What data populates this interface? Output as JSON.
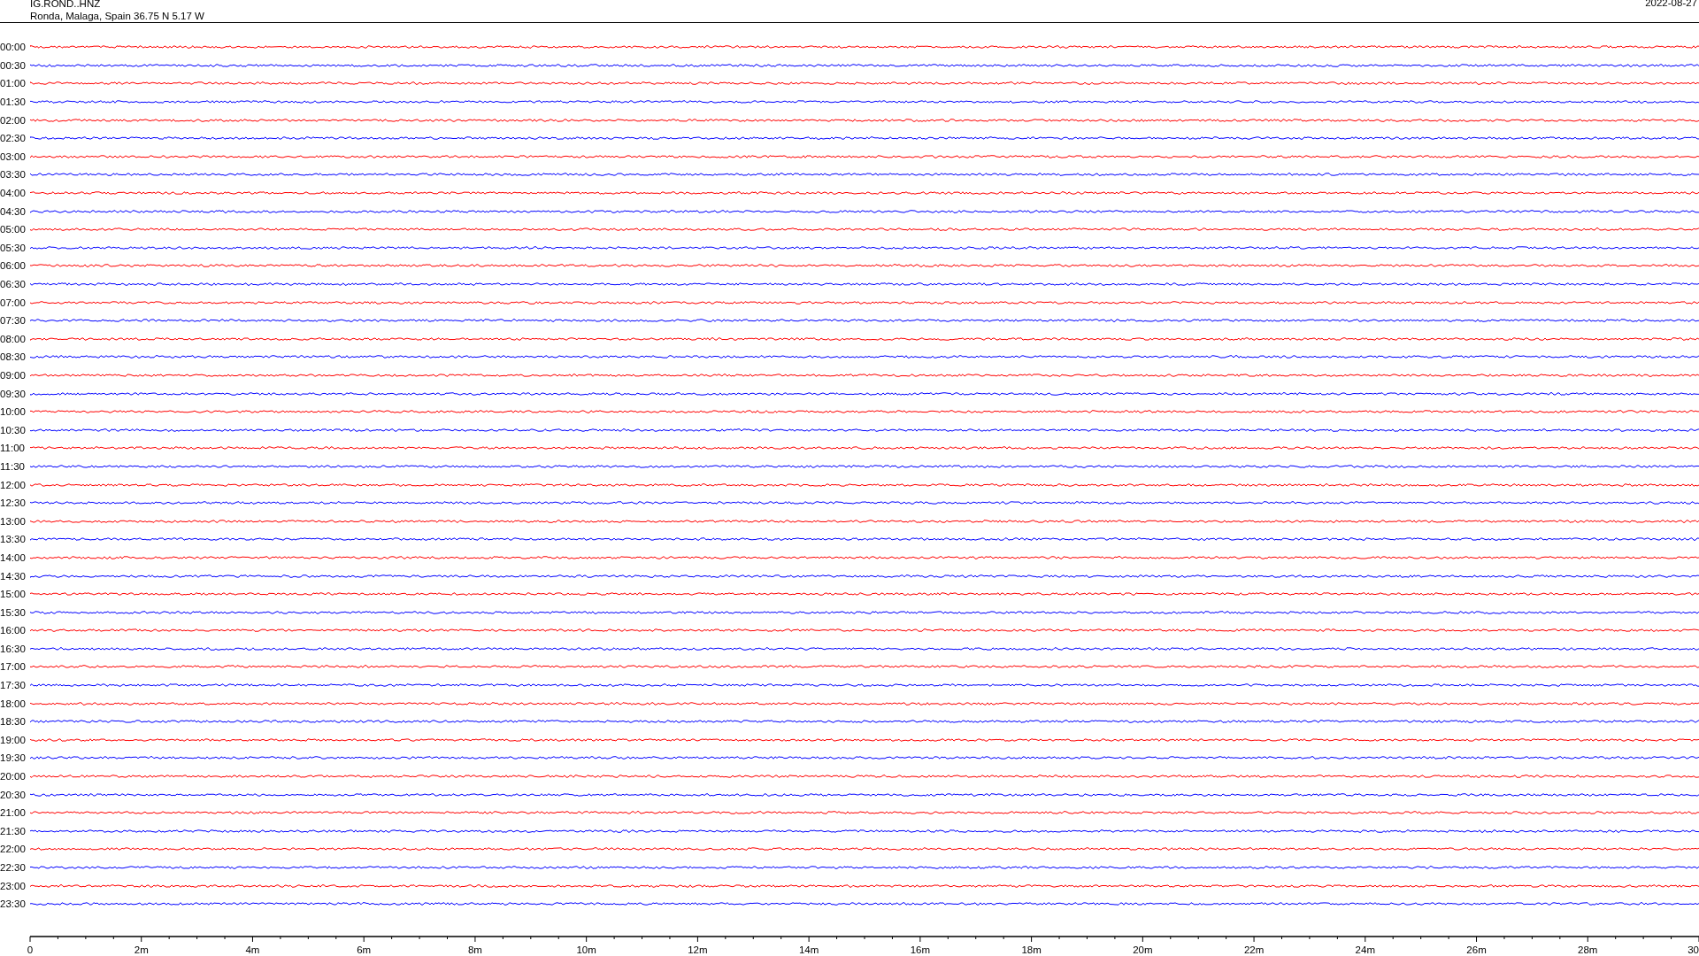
{
  "header": {
    "station": "IG.ROND..HNZ",
    "location": "Ronda, Malaga, Spain  36.75 N 5.17 W",
    "date": "2022-08-27"
  },
  "rows": [
    {
      "time": "00:00",
      "color": "#ff0000"
    },
    {
      "time": "00:30",
      "color": "#0000ff"
    },
    {
      "time": "01:00",
      "color": "#ff0000"
    },
    {
      "time": "01:30",
      "color": "#0000ff"
    },
    {
      "time": "02:00",
      "color": "#ff0000"
    },
    {
      "time": "02:30",
      "color": "#0000ff"
    },
    {
      "time": "03:00",
      "color": "#ff0000"
    },
    {
      "time": "03:30",
      "color": "#0000ff"
    },
    {
      "time": "04:00",
      "color": "#ff0000"
    },
    {
      "time": "04:30",
      "color": "#0000ff"
    },
    {
      "time": "05:00",
      "color": "#ff0000"
    },
    {
      "time": "05:30",
      "color": "#0000ff"
    },
    {
      "time": "06:00",
      "color": "#ff0000"
    },
    {
      "time": "06:30",
      "color": "#0000ff"
    },
    {
      "time": "07:00",
      "color": "#ff0000"
    },
    {
      "time": "07:30",
      "color": "#0000ff"
    },
    {
      "time": "08:00",
      "color": "#ff0000"
    },
    {
      "time": "08:30",
      "color": "#0000ff"
    },
    {
      "time": "09:00",
      "color": "#ff0000"
    },
    {
      "time": "09:30",
      "color": "#0000ff"
    },
    {
      "time": "10:00",
      "color": "#ff0000"
    },
    {
      "time": "10:30",
      "color": "#0000ff"
    },
    {
      "time": "11:00",
      "color": "#ff0000"
    },
    {
      "time": "11:30",
      "color": "#0000ff"
    },
    {
      "time": "12:00",
      "color": "#ff0000"
    },
    {
      "time": "12:30",
      "color": "#0000ff"
    },
    {
      "time": "13:00",
      "color": "#ff0000"
    },
    {
      "time": "13:30",
      "color": "#0000ff"
    },
    {
      "time": "14:00",
      "color": "#ff0000"
    },
    {
      "time": "14:30",
      "color": "#0000ff"
    },
    {
      "time": "15:00",
      "color": "#ff0000"
    },
    {
      "time": "15:30",
      "color": "#0000ff"
    },
    {
      "time": "16:00",
      "color": "#ff0000"
    },
    {
      "time": "16:30",
      "color": "#0000ff"
    },
    {
      "time": "17:00",
      "color": "#ff0000"
    },
    {
      "time": "17:30",
      "color": "#0000ff"
    },
    {
      "time": "18:00",
      "color": "#ff0000"
    },
    {
      "time": "18:30",
      "color": "#0000ff"
    },
    {
      "time": "19:00",
      "color": "#ff0000"
    },
    {
      "time": "19:30",
      "color": "#0000ff"
    },
    {
      "time": "20:00",
      "color": "#ff0000"
    },
    {
      "time": "20:30",
      "color": "#0000ff"
    },
    {
      "time": "21:00",
      "color": "#ff0000"
    },
    {
      "time": "21:30",
      "color": "#0000ff"
    },
    {
      "time": "22:00",
      "color": "#ff0000"
    },
    {
      "time": "22:30",
      "color": "#0000ff"
    },
    {
      "time": "23:00",
      "color": "#ff0000"
    },
    {
      "time": "23:30",
      "color": "#0000ff"
    }
  ],
  "x_axis": {
    "labels": [
      "0",
      "2m",
      "4m",
      "6m",
      "8m",
      "10m",
      "12m",
      "14m",
      "16m",
      "18m",
      "20m",
      "22m",
      "24m",
      "26m",
      "28m",
      "30"
    ]
  }
}
